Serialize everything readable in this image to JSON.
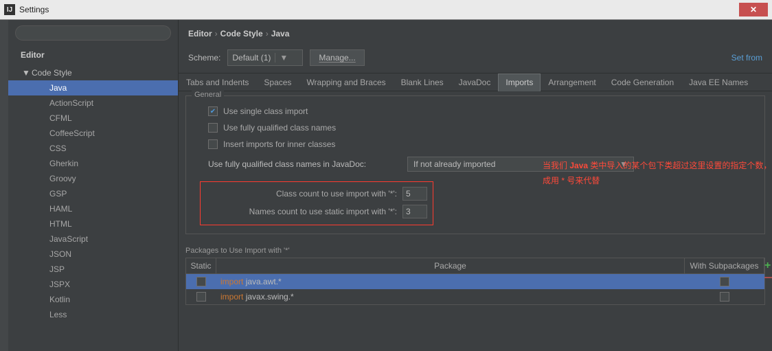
{
  "window": {
    "title": "Settings"
  },
  "sidebar": {
    "section": "Editor",
    "parent": "Code Style",
    "items": [
      "Java",
      "ActionScript",
      "CFML",
      "CoffeeScript",
      "CSS",
      "Gherkin",
      "Groovy",
      "GSP",
      "HAML",
      "HTML",
      "JavaScript",
      "JSON",
      "JSP",
      "JSPX",
      "Kotlin",
      "Less"
    ],
    "selected": "Java"
  },
  "breadcrumb": [
    "Editor",
    "Code Style",
    "Java"
  ],
  "scheme": {
    "label": "Scheme:",
    "value": "Default (1)",
    "manage": "Manage...",
    "right_link": "Set from"
  },
  "tabs": [
    "Tabs and Indents",
    "Spaces",
    "Wrapping and Braces",
    "Blank Lines",
    "JavaDoc",
    "Imports",
    "Arrangement",
    "Code Generation",
    "Java EE Names"
  ],
  "active_tab": "Imports",
  "general": {
    "title": "General",
    "use_single": "Use single class import",
    "use_fully": "Use fully qualified class names",
    "insert_inner": "Insert imports for inner classes",
    "qualified_in_javadoc_label": "Use fully qualified class names in JavaDoc:",
    "qualified_in_javadoc_value": "If not already imported",
    "class_count_label": "Class count to use import with '*':",
    "class_count_value": "5",
    "names_count_label": "Names count to use static import with '*':",
    "names_count_value": "3"
  },
  "annotation": {
    "line1_a": "当我们 ",
    "line1_b": "Java",
    "line1_c": " 类中导入的某个包下类超过这里设置的指定个数，就会换",
    "line2": "成用 * 号来代替"
  },
  "packages": {
    "title": "Packages to Use Import with '*'",
    "head_static": "Static",
    "head_package": "Package",
    "head_sub": "With Subpackages",
    "rows": [
      {
        "pkg": "java.awt.*",
        "selected": true
      },
      {
        "pkg": "javax.swing.*",
        "selected": false
      }
    ]
  }
}
